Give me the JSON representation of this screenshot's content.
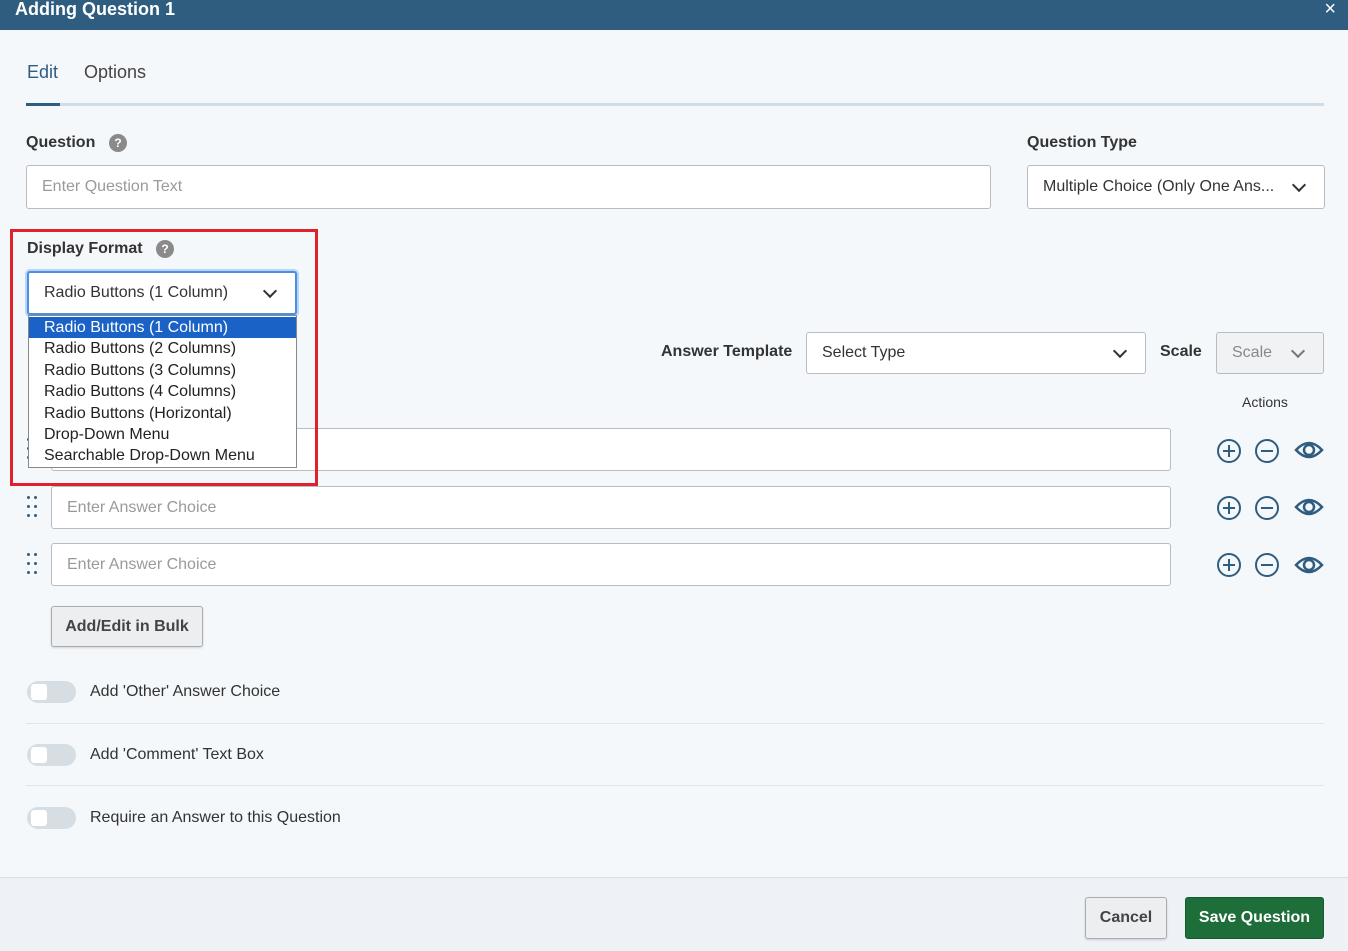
{
  "window": {
    "title": "Adding Question 1",
    "close_icon": "×"
  },
  "tabs": [
    {
      "label": "Edit",
      "active": true
    },
    {
      "label": "Options",
      "active": false
    }
  ],
  "question": {
    "label": "Question",
    "placeholder": "Enter Question Text",
    "help": "?"
  },
  "question_type": {
    "label": "Question Type",
    "value": "Multiple Choice (Only One Ans..."
  },
  "display_format": {
    "label": "Display Format",
    "help": "?",
    "value": "Radio Buttons (1 Column)",
    "options": [
      "Radio Buttons (1 Column)",
      "Radio Buttons (2 Columns)",
      "Radio Buttons (3 Columns)",
      "Radio Buttons (4 Columns)",
      "Radio Buttons (Horizontal)",
      "Drop-Down Menu",
      "Searchable Drop-Down Menu"
    ],
    "selected_index": 0
  },
  "answer_template": {
    "label": "Answer Template",
    "value": "Select Type"
  },
  "scale": {
    "label": "Scale",
    "value": "Scale"
  },
  "actions_label": "Actions",
  "answers": [
    {
      "placeholder": "Enter Answer Choice"
    },
    {
      "placeholder": "Enter Answer Choice"
    },
    {
      "placeholder": "Enter Answer Choice"
    }
  ],
  "bulk_button": "Add/Edit in Bulk",
  "toggles": [
    {
      "label": "Add 'Other' Answer Choice",
      "on": false
    },
    {
      "label": "Add 'Comment' Text Box",
      "on": false
    },
    {
      "label": "Require an Answer to this Question",
      "on": false
    }
  ],
  "footer": {
    "cancel": "Cancel",
    "save": "Save Question"
  },
  "colors": {
    "header": "#2f5d80",
    "accent": "#2f5d80",
    "highlight": "#e0202a",
    "save": "#1e6e3a",
    "selected_option": "#1a62c5"
  }
}
